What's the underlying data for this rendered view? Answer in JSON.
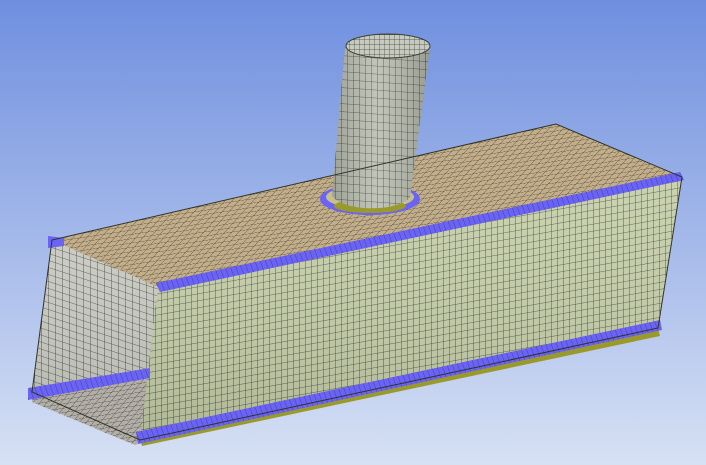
{
  "viewport": {
    "background_top": "#6f8fdf",
    "background_bottom": "#d7e1f4"
  },
  "mesh": {
    "mesh_line_color": "#3c4036",
    "side_face_fill": "#c7d0ac",
    "front_face_fill": "#a9b289",
    "top_face_fill": "#c4ae8a",
    "bottom_face_fill": "#b9b3ab",
    "pipe_fill": "#b9bdb0",
    "edge_highlight_color": "#6a63f5",
    "edge_underside_color": "#9a9a2a"
  }
}
